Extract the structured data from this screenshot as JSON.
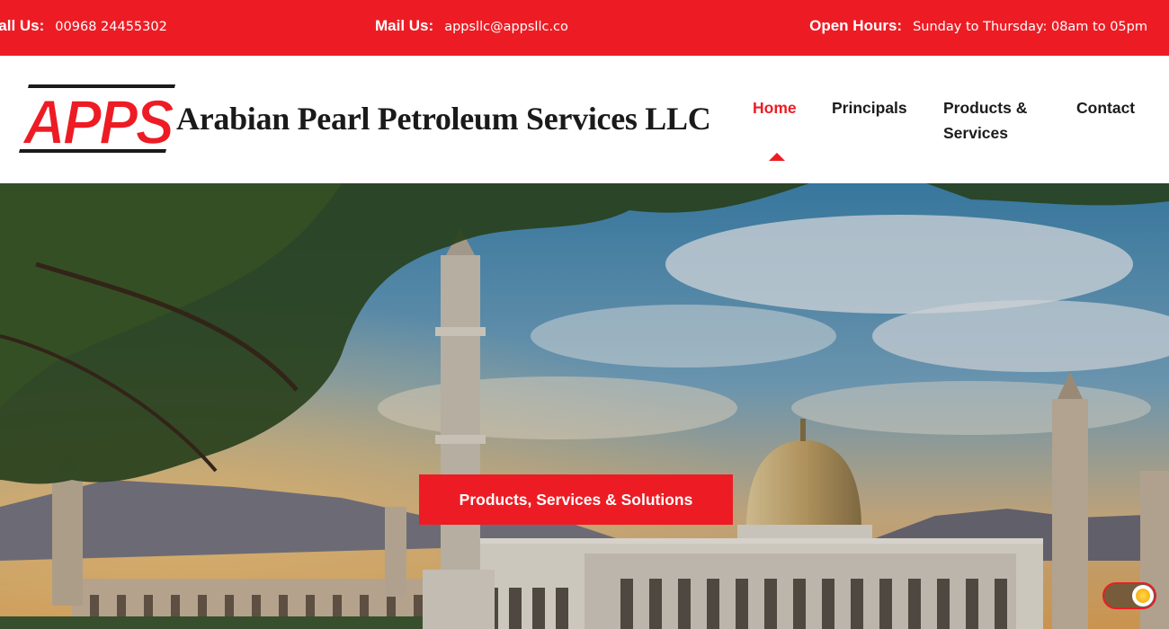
{
  "topbar": {
    "phone_label": "Call Us:",
    "phone_value": "00968 24455302",
    "mail_label": "Mail Us:",
    "mail_value": "appsllc@appsllc.co",
    "hours_label": "Open Hours:",
    "hours_value": "Sunday to Thursday: 08am to 05pm"
  },
  "header": {
    "logo_letters": "APPS",
    "company_name": "Arabian Pearl Petroleum Services LLC"
  },
  "nav": {
    "items": [
      {
        "label": "Home",
        "active": true
      },
      {
        "label": "Principals",
        "active": false
      },
      {
        "label": "Products & Services",
        "active": false
      },
      {
        "label": "Contact",
        "active": false
      }
    ]
  },
  "hero": {
    "cta_label": "Products, Services & Solutions",
    "toggle_icon": "sun-icon"
  },
  "colors": {
    "brand_red": "#ed1c24",
    "text_dark": "#1c1c1c"
  }
}
